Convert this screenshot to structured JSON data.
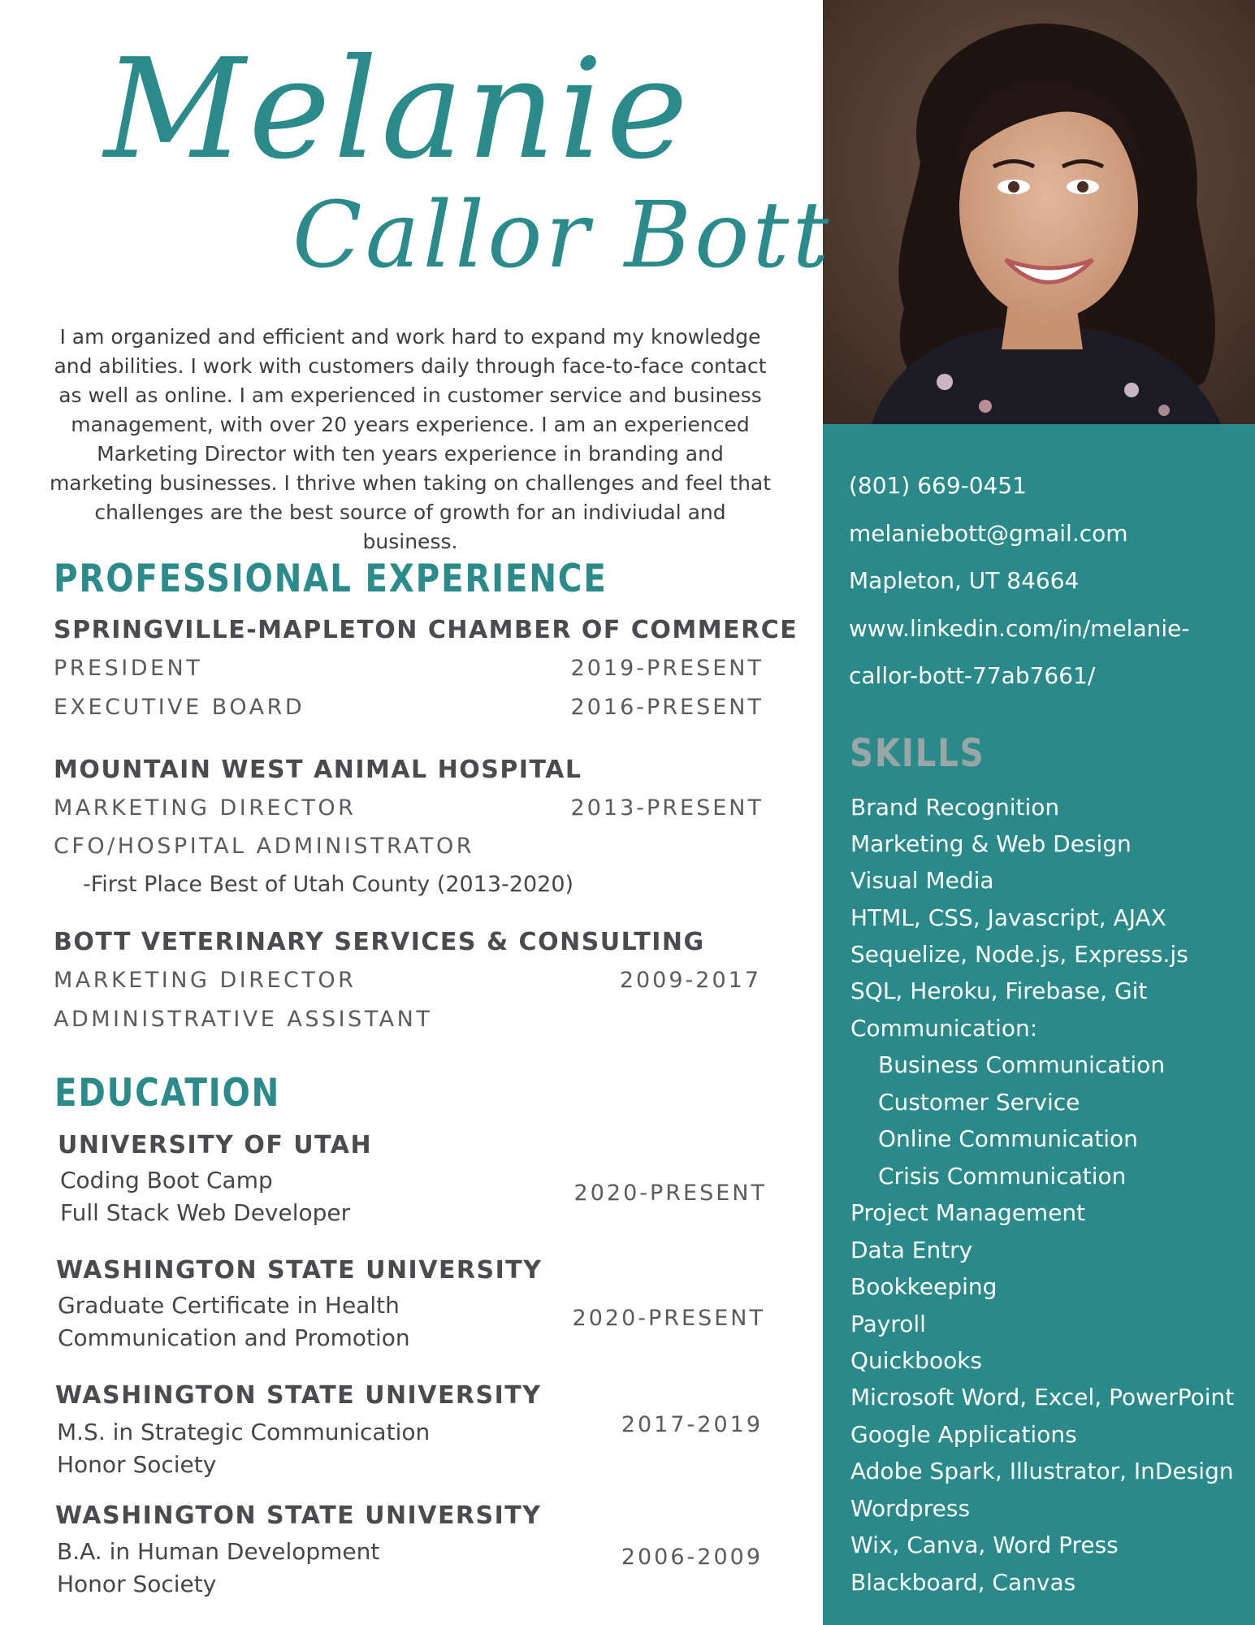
{
  "name": {
    "first": "Melanie",
    "last": "Callor Bott"
  },
  "summary": "I am organized and efficient and work hard to expand my knowledge and abilities. I work with customers daily through face-to-face contact as well as online. I am experienced in customer service and business management, with over 20 years experience. I am an experienced Marketing Director with ten years experience in branding and marketing businesses. I thrive when taking on challenges and feel that challenges are the best source of growth for an indiviudal and business.",
  "experience": {
    "title": "PROFESSIONAL EXPERIENCE",
    "jobs": [
      {
        "org": "SPRINGVILLE-MAPLETON CHAMBER OF COMMERCE",
        "roles": [
          {
            "title": "PRESIDENT",
            "dates": "2019-PRESENT"
          },
          {
            "title": "EXECUTIVE BOARD",
            "dates": "2016-PRESENT"
          }
        ]
      },
      {
        "org": "MOUNTAIN WEST ANIMAL HOSPITAL",
        "roles": [
          {
            "title": "MARKETING DIRECTOR",
            "dates": "2013-PRESENT"
          },
          {
            "title": "CFO/HOSPITAL ADMINISTRATOR",
            "dates": ""
          }
        ],
        "note": "-First Place Best of Utah County (2013-2020)"
      },
      {
        "org": "BOTT VETERINARY SERVICES & CONSULTING",
        "roles": [
          {
            "title": "MARKETING DIRECTOR",
            "dates": "2009-2017"
          },
          {
            "title": "ADMINISTRATIVE ASSISTANT",
            "dates": ""
          }
        ]
      }
    ]
  },
  "education": {
    "title": "EDUCATION",
    "schools": [
      {
        "name": "UNIVERSITY OF UTAH",
        "lines": [
          "Coding Boot Camp",
          "Full Stack Web Developer"
        ],
        "dates": "2020-PRESENT"
      },
      {
        "name": "WASHINGTON STATE UNIVERSITY",
        "lines": [
          "Graduate Certificate in Health",
          "Communication and Promotion"
        ],
        "dates": "2020-PRESENT"
      },
      {
        "name": "WASHINGTON STATE UNIVERSITY",
        "lines": [
          "M.S. in Strategic Communication",
          "Honor Society"
        ],
        "dates": "2017-2019"
      },
      {
        "name": "WASHINGTON STATE UNIVERSITY",
        "lines": [
          "B.A. in Human Development",
          "Honor Society"
        ],
        "dates": "2006-2009"
      }
    ]
  },
  "contact": {
    "phone": "(801) 669-0451",
    "email": "melaniebott@gmail.com",
    "location": "Mapleton, UT 84664",
    "linkedin_line1": "www.linkedin.com/in/melanie-",
    "linkedin_line2": "callor-bott-77ab7661/"
  },
  "skills": {
    "title": "SKILLS",
    "items": [
      {
        "label": "Brand Recognition",
        "indent": false
      },
      {
        "label": "Marketing & Web Design",
        "indent": false
      },
      {
        "label": "Visual Media",
        "indent": false
      },
      {
        "label": "HTML, CSS, Javascript, AJAX",
        "indent": false
      },
      {
        "label": "Sequelize, Node.js, Express.js",
        "indent": false
      },
      {
        "label": "SQL, Heroku, Firebase, Git",
        "indent": false
      },
      {
        "label": "Communication:",
        "indent": false
      },
      {
        "label": "Business Communication",
        "indent": true
      },
      {
        "label": "Customer Service",
        "indent": true
      },
      {
        "label": "Online Communication",
        "indent": true
      },
      {
        "label": "Crisis Communication",
        "indent": true
      },
      {
        "label": "Project Management",
        "indent": false
      },
      {
        "label": "Data Entry",
        "indent": false
      },
      {
        "label": "Bookkeeping",
        "indent": false
      },
      {
        "label": "Payroll",
        "indent": false
      },
      {
        "label": "Quickbooks",
        "indent": false
      },
      {
        "label": "Microsoft Word, Excel, PowerPoint",
        "indent": false
      },
      {
        "label": "Google Applications",
        "indent": false
      },
      {
        "label": "Adobe Spark, Illustrator, InDesign",
        "indent": false
      },
      {
        "label": "Wordpress",
        "indent": false
      },
      {
        "label": "Wix, Canva, Word Press",
        "indent": false
      },
      {
        "label": "Blackboard, Canvas",
        "indent": false
      }
    ]
  },
  "colors": {
    "accent": "#2a8a89",
    "text": "#4e4e52",
    "skills_title": "#9aa5a8"
  }
}
